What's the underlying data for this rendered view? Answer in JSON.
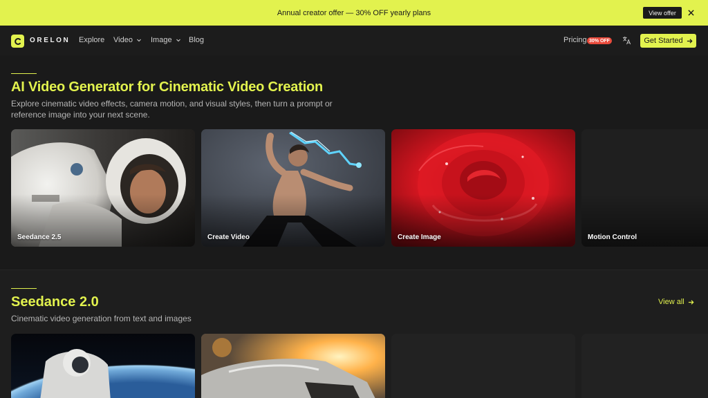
{
  "promo": {
    "text": "Annual creator offer — 30% OFF yearly plans",
    "button": "View offer",
    "close_icon": "close-icon"
  },
  "nav": {
    "logo_icon": "c-logo-icon",
    "brand": "ORELON",
    "links": [
      "Explore",
      "Video",
      "Image",
      "Blog"
    ],
    "pricing": "Pricing",
    "pricing_badge": "30% OFF",
    "translate_icon": "translate-icon",
    "cta": "Get Started"
  },
  "hero": {
    "title": "AI Video Generator for Cinematic Video Creation",
    "subtitle": "Explore cinematic video effects, camera motion, and visual styles, then turn a prompt or reference image into your next scene.",
    "cards": [
      {
        "label": "Seedance 2.5"
      },
      {
        "label": "Create Video"
      },
      {
        "label": "Create Image"
      },
      {
        "label": "Motion Control"
      }
    ]
  },
  "section2": {
    "title": "Seedance 2.0",
    "subtitle": "Cinematic video generation from text and images",
    "view_all": "View all"
  },
  "colors": {
    "accent": "#e2f24e",
    "background": "#1a1a1a",
    "badge": "#e94b3c"
  }
}
